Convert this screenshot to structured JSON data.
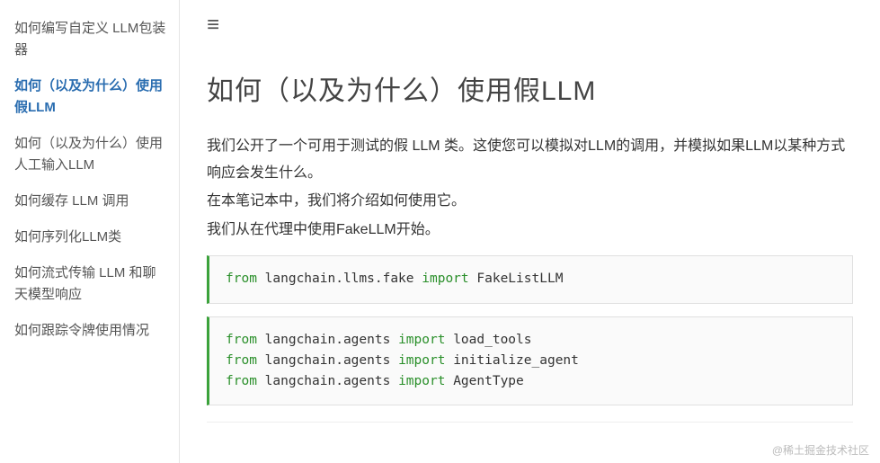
{
  "sidebar": {
    "items": [
      {
        "label": "如何编写自定义 LLM包装器",
        "active": false
      },
      {
        "label": "如何（以及为什么）使用假LLM",
        "active": true
      },
      {
        "label": "如何（以及为什么）使用人工输入LLM",
        "active": false
      },
      {
        "label": "如何缓存 LLM 调用",
        "active": false
      },
      {
        "label": "如何序列化LLM类",
        "active": false
      },
      {
        "label": "如何流式传输 LLM 和聊天模型响应",
        "active": false
      },
      {
        "label": "如何跟踪令牌使用情况",
        "active": false
      }
    ]
  },
  "menu_icon": "≡",
  "title": "如何（以及为什么）使用假LLM",
  "paragraphs": [
    "我们公开了一个可用于测试的假 LLM 类。这使您可以模拟对LLM的调用，并模拟如果LLM以某种方式响应会发生什么。",
    "在本笔记本中，我们将介绍如何使用它。",
    "我们从在代理中使用FakeLLM开始。"
  ],
  "code_blocks": [
    [
      {
        "from": "from",
        "module": "langchain.llms.fake",
        "import": "import",
        "name": "FakeListLLM"
      }
    ],
    [
      {
        "from": "from",
        "module": "langchain.agents",
        "import": "import",
        "name": "load_tools"
      },
      {
        "from": "from",
        "module": "langchain.agents",
        "import": "import",
        "name": "initialize_agent"
      },
      {
        "from": "from",
        "module": "langchain.agents",
        "import": "import",
        "name": "AgentType"
      }
    ]
  ],
  "watermark": "@稀土掘金技术社区"
}
